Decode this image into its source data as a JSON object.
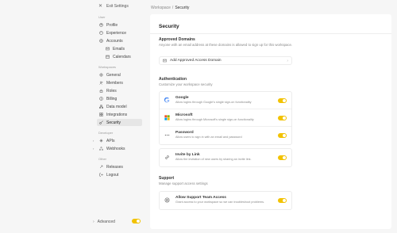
{
  "sidebar": {
    "exit_label": "Exit Settings",
    "sections": {
      "user": "User",
      "workspaces": "Workspaces",
      "developer": "Developer",
      "other": "Other"
    },
    "items": {
      "profile": "Profile",
      "experience": "Experience",
      "accounts": "Accounts",
      "emails": "Emails",
      "calendars": "Calendars",
      "general": "General",
      "members": "Members",
      "roles": "Roles",
      "billing": "Billing",
      "data_model": "Data model",
      "integrations": "Integrations",
      "security": "Security",
      "apis": "APIs",
      "webhooks": "Webhooks",
      "releases": "Releases",
      "logout": "Logout"
    },
    "advanced_label": "Advanced",
    "advanced_on": true
  },
  "breadcrumb": {
    "parent": "Workspace",
    "separator": "/",
    "current": "Security"
  },
  "main": {
    "title": "Security",
    "approved_domains": {
      "title": "Approved Domains",
      "description": "Anyone with an email address at these domains is allowed to sign up for this workspace.",
      "add_button": "Add Approved Access Domain"
    },
    "authentication": {
      "title": "Authentication",
      "description": "Customize your workspace security",
      "rows": [
        {
          "title": "Google",
          "desc": "Allow logins through Google's single sign-on functionality",
          "icon": "google-icon",
          "enabled": true
        },
        {
          "title": "Microsoft",
          "desc": "Allow logins through Microsoft's single sign-on functionality",
          "icon": "microsoft-icon",
          "enabled": true
        },
        {
          "title": "Password",
          "desc": "Allow users to sign in with an email and password",
          "icon": "password-icon",
          "enabled": true
        }
      ],
      "invite": {
        "title": "Invite by Link",
        "desc": "Allow the invitation of new users by sharing an invite link.",
        "icon": "link-icon",
        "enabled": true
      }
    },
    "support": {
      "title": "Support",
      "description": "Manage support access settings",
      "row": {
        "title": "Allow Support Team Access",
        "desc": "Grant access to your workspace so we can troubleshoot problems.",
        "icon": "support-icon",
        "enabled": true
      }
    }
  },
  "colors": {
    "accent": "#f2c200",
    "background": "#f6f6f6",
    "panel": "#ffffff"
  }
}
